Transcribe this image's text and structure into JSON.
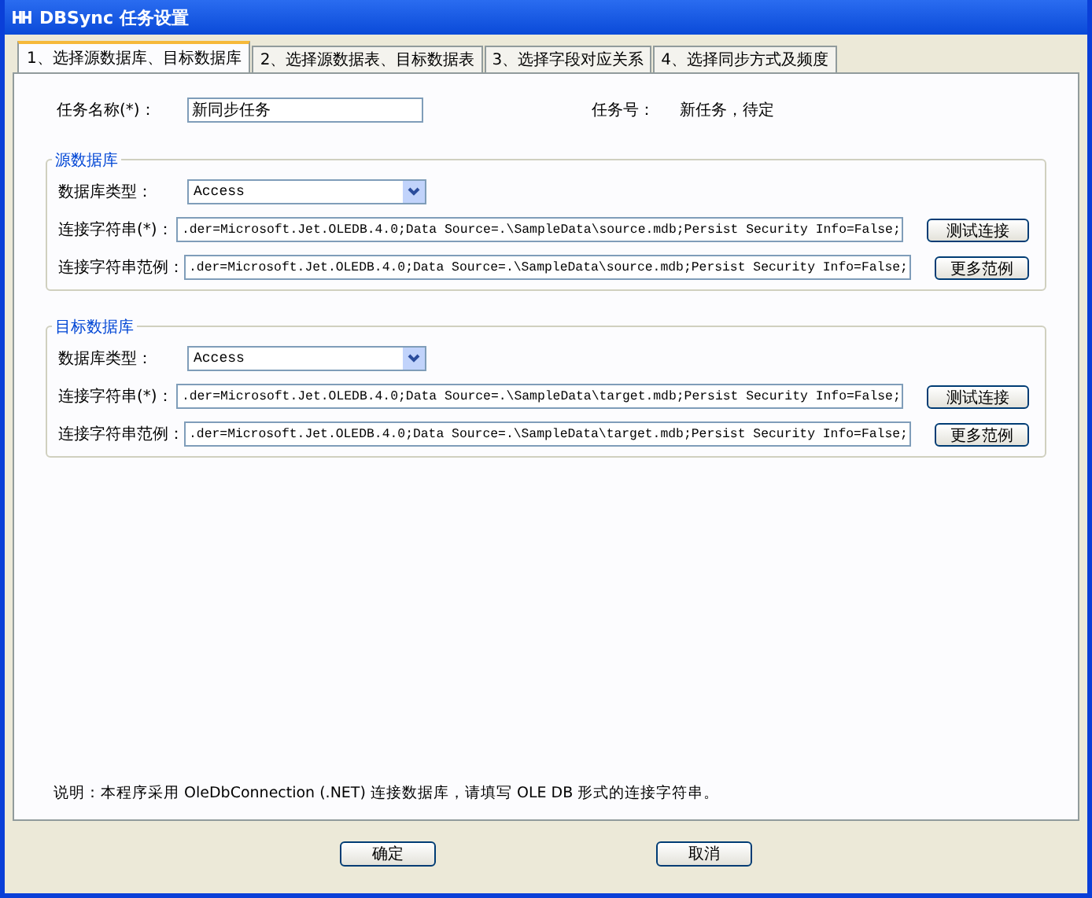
{
  "window": {
    "title": "DBSync  任务设置"
  },
  "tabs": [
    {
      "label": "1、选择源数据库、目标数据库",
      "selected": true
    },
    {
      "label": "2、选择源数据表、目标数据表",
      "selected": false
    },
    {
      "label": "3、选择字段对应关系",
      "selected": false
    },
    {
      "label": "4、选择同步方式及频度",
      "selected": false
    }
  ],
  "task_name": {
    "label": "任务名称(*)：",
    "value": "新同步任务"
  },
  "task_number": {
    "label": "任务号：",
    "value": "新任务，待定"
  },
  "groups": [
    {
      "title": "源数据库",
      "db_type": {
        "label": "数据库类型：",
        "value": "Access"
      },
      "fields": [
        {
          "label": "连接字符串(*)：",
          "value": ".der=Microsoft.Jet.OLEDB.4.0;Data Source=.\\SampleData\\source.mdb;Persist Security Info=False;",
          "button": "测试连接"
        },
        {
          "label": "连接字符串范例：",
          "value": ".der=Microsoft.Jet.OLEDB.4.0;Data Source=.\\SampleData\\source.mdb;Persist Security Info=False;",
          "button": "更多范例"
        }
      ]
    },
    {
      "title": "目标数据库",
      "db_type": {
        "label": "数据库类型：",
        "value": "Access"
      },
      "fields": [
        {
          "label": "连接字符串(*)：",
          "value": ".der=Microsoft.Jet.OLEDB.4.0;Data Source=.\\SampleData\\target.mdb;Persist Security Info=False;",
          "button": "测试连接"
        },
        {
          "label": "连接字符串范例：",
          "value": ".der=Microsoft.Jet.OLEDB.4.0;Data Source=.\\SampleData\\target.mdb;Persist Security Info=False;",
          "button": "更多范例"
        }
      ]
    }
  ],
  "note": "说明：本程序采用 OleDbConnection (.NET) 连接数据库，请填写 OLE DB 形式的连接字符串。",
  "buttons": [
    "确定",
    "取消"
  ]
}
